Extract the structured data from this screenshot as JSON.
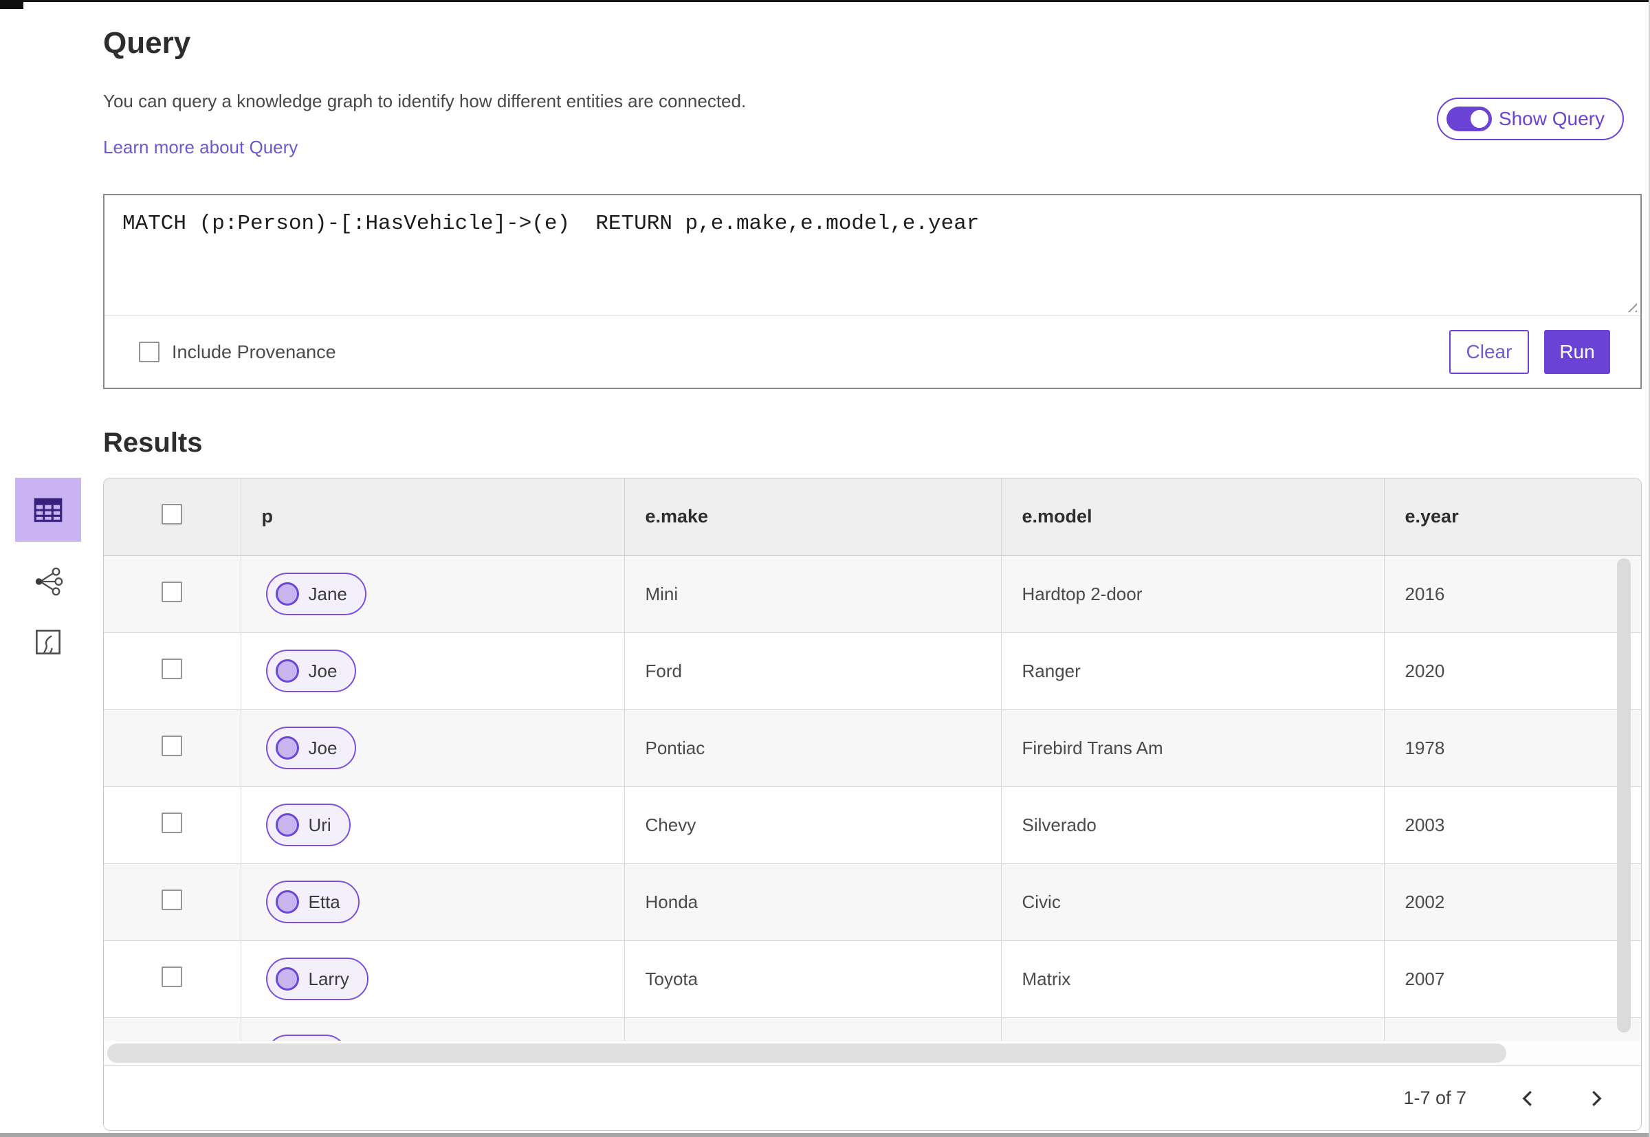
{
  "header": {
    "title": "Query",
    "description": "You can query a knowledge graph to identify how different entities are connected.",
    "learn_more_link": "Learn more about Query",
    "show_query_toggle": {
      "label": "Show Query",
      "state": "on"
    }
  },
  "query_panel": {
    "query_text": "MATCH (p:Person)-[:HasVehicle]->(e)  RETURN p,e.make,e.model,e.year",
    "include_provenance": {
      "label": "Include Provenance",
      "checked": false
    },
    "clear_button": "Clear",
    "run_button": "Run"
  },
  "results": {
    "title": "Results",
    "view_switcher": [
      {
        "name": "table-view",
        "icon": "table-icon",
        "selected": true
      },
      {
        "name": "graph-view",
        "icon": "link-chart-icon",
        "selected": false
      },
      {
        "name": "map-view",
        "icon": "map-icon",
        "selected": false
      }
    ],
    "table": {
      "columns": [
        "p",
        "e.make",
        "e.model",
        "e.year"
      ],
      "rows": [
        {
          "p": "Jane",
          "make": "Mini",
          "model": "Hardtop 2-door",
          "year": "2016"
        },
        {
          "p": "Joe",
          "make": "Ford",
          "model": "Ranger",
          "year": "2020"
        },
        {
          "p": "Joe",
          "make": "Pontiac",
          "model": "Firebird Trans Am",
          "year": "1978"
        },
        {
          "p": "Uri",
          "make": "Chevy",
          "model": "Silverado",
          "year": "2003"
        },
        {
          "p": "Etta",
          "make": "Honda",
          "model": "Civic",
          "year": "2002"
        },
        {
          "p": "Larry",
          "make": "Toyota",
          "model": "Matrix",
          "year": "2007"
        },
        {
          "p": "",
          "make": "",
          "model": "",
          "year": "",
          "partial": true
        }
      ]
    },
    "pagination": {
      "range": "1-7 of 7",
      "prev_icon": "chevron-left-icon",
      "next_icon": "chevron-right-icon"
    }
  },
  "colors": {
    "accent": "#6a42d4",
    "accent_light": "#c9b3f2",
    "pill_border": "#7b50e0",
    "header_bg": "#f0efef",
    "alt_row_bg": "#f7f7f7"
  }
}
